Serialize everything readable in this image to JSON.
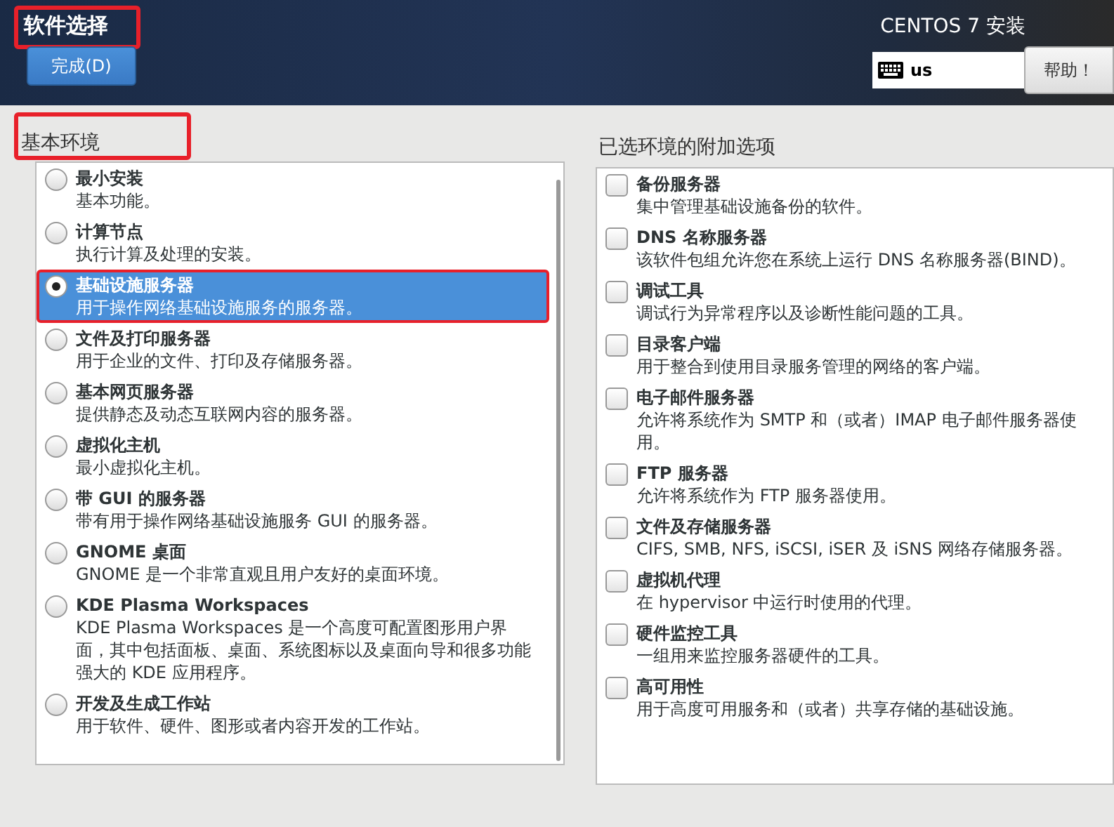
{
  "header": {
    "title": "软件选择",
    "title_annotated": true,
    "done_button": "完成(D)",
    "product": "CENTOS 7 安装",
    "keyboard_layout": "us",
    "help_button": "帮助！"
  },
  "environments": {
    "heading": "基本环境",
    "heading_annotated": true,
    "items": [
      {
        "name": "最小安装",
        "description": "基本功能。",
        "selected": false,
        "annotated": false
      },
      {
        "name": "计算节点",
        "description": "执行计算及处理的安装。",
        "selected": false,
        "annotated": false
      },
      {
        "name": "基础设施服务器",
        "description": "用于操作网络基础设施服务的服务器。",
        "selected": true,
        "annotated": true
      },
      {
        "name": "文件及打印服务器",
        "description": "用于企业的文件、打印及存储服务器。",
        "selected": false,
        "annotated": false
      },
      {
        "name": "基本网页服务器",
        "description": "提供静态及动态互联网内容的服务器。",
        "selected": false,
        "annotated": false
      },
      {
        "name": "虚拟化主机",
        "description": "最小虚拟化主机。",
        "selected": false,
        "annotated": false
      },
      {
        "name": "带 GUI 的服务器",
        "description": "带有用于操作网络基础设施服务 GUI 的服务器。",
        "selected": false,
        "annotated": false
      },
      {
        "name": "GNOME 桌面",
        "description": "GNOME 是一个非常直观且用户友好的桌面环境。",
        "selected": false,
        "annotated": false
      },
      {
        "name": "KDE Plasma Workspaces",
        "description": "KDE Plasma Workspaces 是一个高度可配置图形用户界面，其中包括面板、桌面、系统图标以及桌面向导和很多功能强大的 KDE 应用程序。",
        "selected": false,
        "annotated": false
      },
      {
        "name": "开发及生成工作站",
        "description": "用于软件、硬件、图形或者内容开发的工作站。",
        "selected": false,
        "annotated": false
      }
    ]
  },
  "addons": {
    "heading": "已选环境的附加选项",
    "items": [
      {
        "name": "备份服务器",
        "description": "集中管理基础设施备份的软件。",
        "checked": false
      },
      {
        "name": "DNS 名称服务器",
        "description": "该软件包组允许您在系统上运行 DNS 名称服务器(BIND)。",
        "checked": false
      },
      {
        "name": "调试工具",
        "description": "调试行为异常程序以及诊断性能问题的工具。",
        "checked": false
      },
      {
        "name": "目录客户端",
        "description": "用于整合到使用目录服务管理的网络的客户端。",
        "checked": false
      },
      {
        "name": "电子邮件服务器",
        "description": "允许将系统作为 SMTP 和（或者）IMAP 电子邮件服务器使用。",
        "checked": false
      },
      {
        "name": "FTP 服务器",
        "description": "允许将系统作为 FTP 服务器使用。",
        "checked": false
      },
      {
        "name": "文件及存储服务器",
        "description": "CIFS, SMB, NFS, iSCSI, iSER 及 iSNS 网络存储服务器。",
        "checked": false
      },
      {
        "name": "虚拟机代理",
        "description": "在 hypervisor 中运行时使用的代理。",
        "checked": false
      },
      {
        "name": "硬件监控工具",
        "description": "一组用来监控服务器硬件的工具。",
        "checked": false
      },
      {
        "name": "高可用性",
        "description": "用于高度可用服务和（或者）共享存储的基础设施。",
        "checked": false
      }
    ]
  }
}
